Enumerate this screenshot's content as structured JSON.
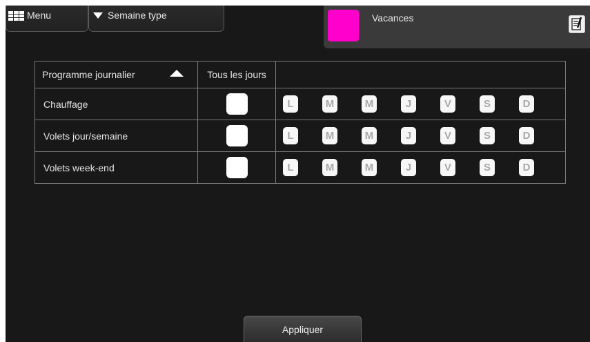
{
  "top_bar": {
    "menu_label": "Menu",
    "mode_label": "Semaine type",
    "icons": {
      "menu": "grid-icon",
      "mode": "triangle-down-icon",
      "edit": "edit-note-icon"
    }
  },
  "vacation": {
    "label": "Vacances",
    "color": "#ff00cc"
  },
  "table": {
    "header": {
      "program_label": "Programme journalier",
      "all_days_label": "Tous les jours",
      "sort_icon": "triangle-up-icon"
    },
    "rows": [
      {
        "name": "Chauffage",
        "days": [
          "L",
          "M",
          "M",
          "J",
          "V",
          "S",
          "D"
        ]
      },
      {
        "name": "Volets jour/semaine",
        "days": [
          "L",
          "M",
          "M",
          "J",
          "V",
          "S",
          "D"
        ]
      },
      {
        "name": "Volets week-end",
        "days": [
          "L",
          "M",
          "M",
          "J",
          "V",
          "S",
          "D"
        ]
      }
    ]
  },
  "apply_label": "Appliquer"
}
